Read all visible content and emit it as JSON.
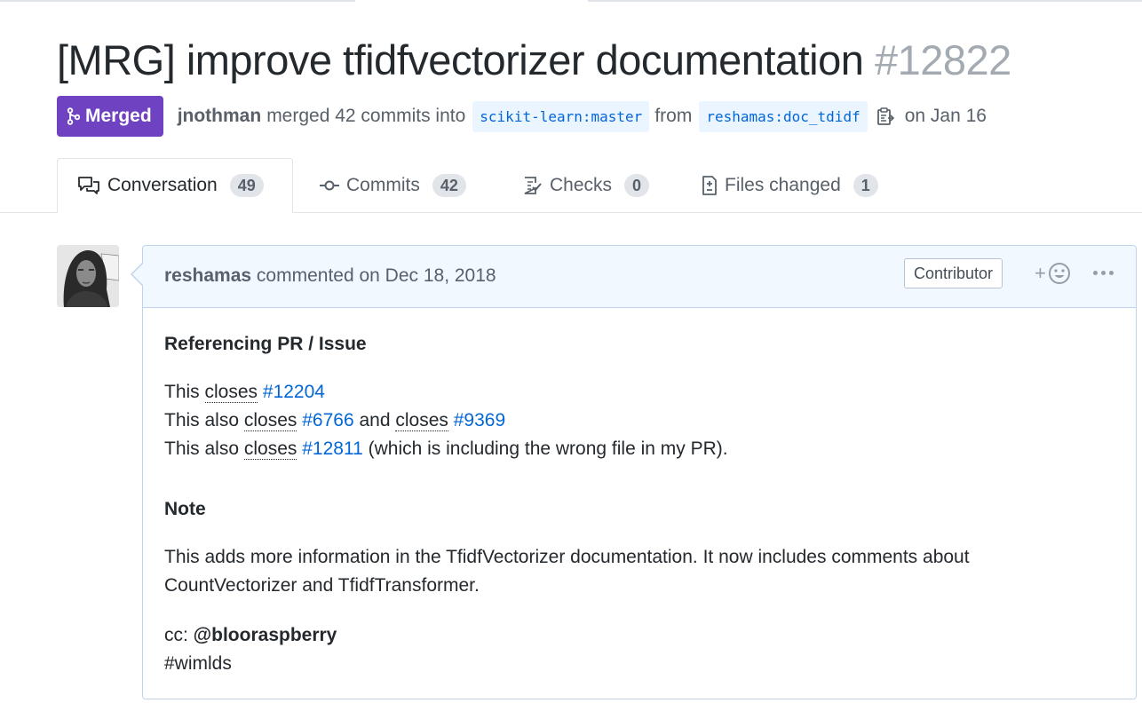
{
  "pr": {
    "title": "[MRG] improve tfidfvectorizer documentation",
    "number": "#12822",
    "state": "Merged",
    "merged_by": "jnothman",
    "merged_text": "merged 42 commits into",
    "base_branch": "scikit-learn:master",
    "from_text": "from",
    "head_branch": "reshamas:doc_tdidf",
    "date_text": "on Jan 16"
  },
  "tabs": [
    {
      "label": "Conversation",
      "count": "49"
    },
    {
      "label": "Commits",
      "count": "42"
    },
    {
      "label": "Checks",
      "count": "0"
    },
    {
      "label": "Files changed",
      "count": "1"
    }
  ],
  "comment": {
    "author": "reshamas",
    "action": "commented on Dec 18, 2018",
    "role": "Contributor",
    "react_plus": "+",
    "heading1": "Referencing PR / Issue",
    "line1": {
      "pre": "This ",
      "kw": "closes",
      "ref": "#12204"
    },
    "line2": {
      "pre": "This also ",
      "kw1": "closes",
      "ref1": "#6766",
      "mid": " and ",
      "kw2": "closes",
      "ref2": "#9369"
    },
    "line3": {
      "pre": "This also ",
      "kw": "closes",
      "ref": "#12811",
      "post": " (which is including the wrong file in my PR)."
    },
    "heading2": "Note",
    "para1": "This adds more information in the TfidfVectorizer documentation. It now includes comments about",
    "para2": "CountVectorizer and TfidfTransformer.",
    "cc_label": "cc: ",
    "cc_mention": "@blooraspberry",
    "hashtag": "#wimlds"
  },
  "colors": {
    "merged": "#6f42c1",
    "link": "#0366d6",
    "branch_bg": "#eaf5ff",
    "header_bg": "#f1f8ff"
  }
}
